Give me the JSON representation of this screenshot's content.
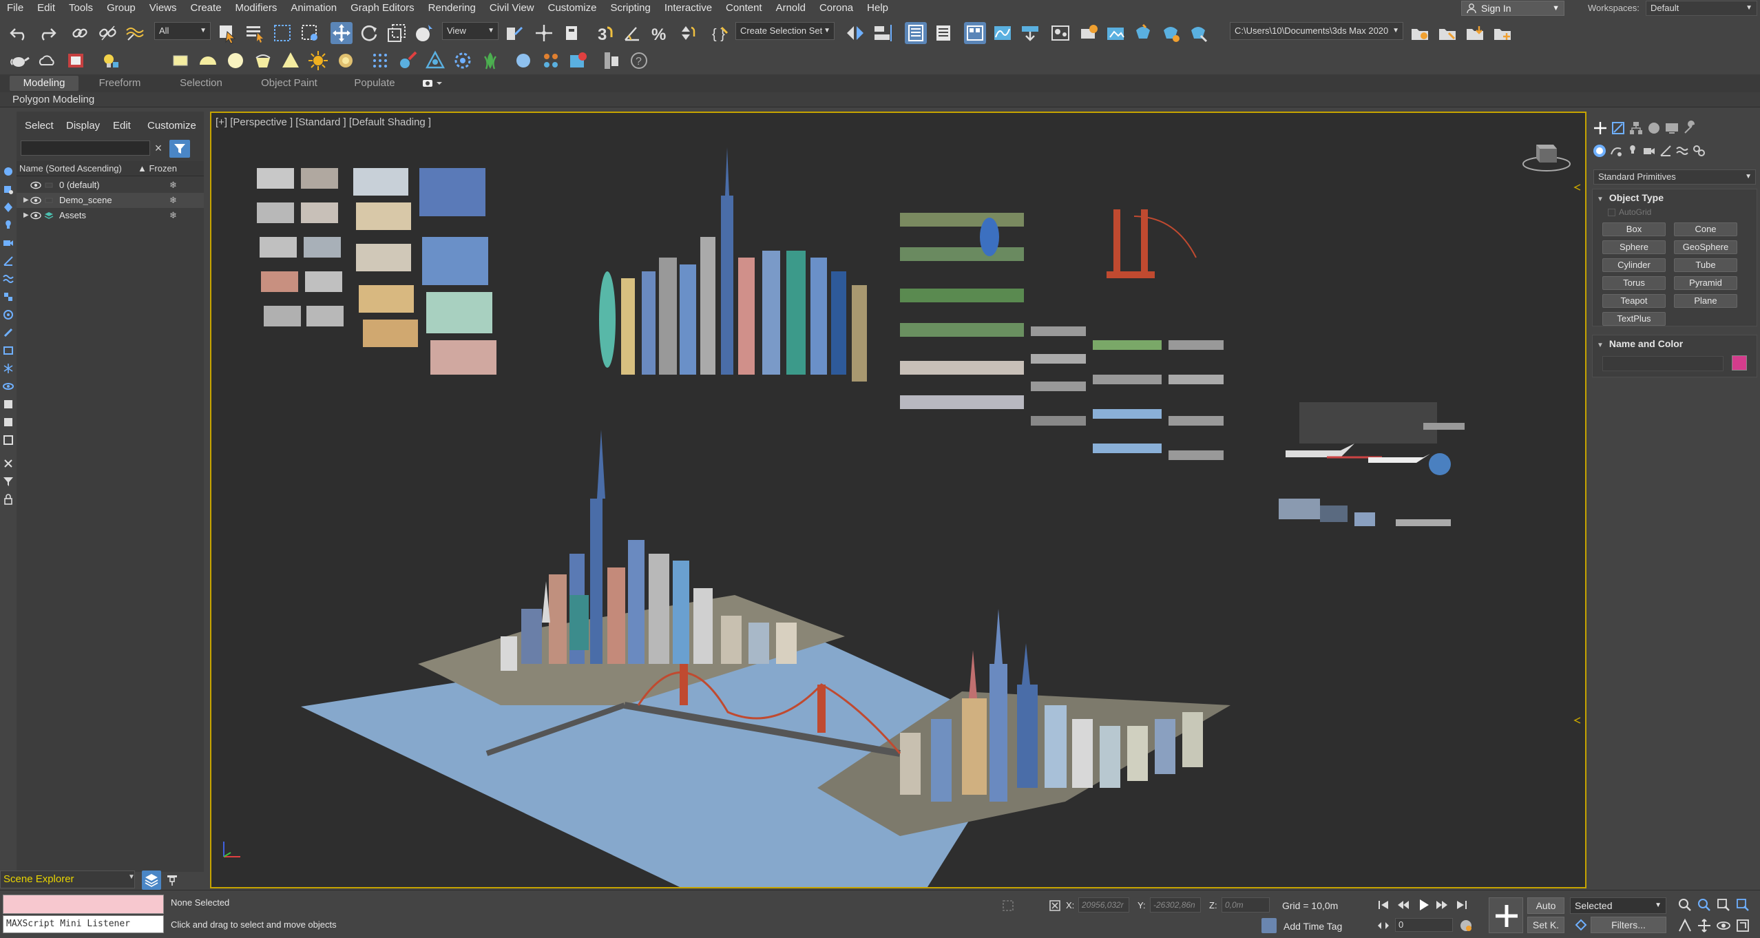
{
  "menu": [
    "File",
    "Edit",
    "Tools",
    "Group",
    "Views",
    "Create",
    "Modifiers",
    "Animation",
    "Graph Editors",
    "Rendering",
    "Civil View",
    "Customize",
    "Scripting",
    "Interactive",
    "Content",
    "Arnold",
    "Corona",
    "Help"
  ],
  "account": {
    "signin": "Sign In",
    "workspaces_label": "Workspaces:",
    "workspace": "Default"
  },
  "toolbar": {
    "selection_filter": "All",
    "ref_coord": "View",
    "named_selection": "Create Selection Set",
    "project_path": "C:\\Users\\10\\Documents\\3ds Max 2020"
  },
  "ribbon": {
    "tabs": [
      "Modeling",
      "Freeform",
      "Selection",
      "Object Paint",
      "Populate"
    ],
    "active_tab": "Modeling",
    "panel": "Polygon Modeling"
  },
  "explorer": {
    "menus": [
      "Select",
      "Display",
      "Edit",
      "Customize"
    ],
    "columns": {
      "name": "Name (Sorted Ascending)",
      "frozen": "▲ Frozen"
    },
    "rows": [
      {
        "name": "0 (default)",
        "expandable": false
      },
      {
        "name": "Demo_scene",
        "expandable": true
      },
      {
        "name": "Assets",
        "expandable": true
      }
    ],
    "footer_label": "Scene Explorer"
  },
  "viewport": {
    "label": "[+] [Perspective ] [Standard ] [Default Shading ]",
    "colors": {
      "border": "#c6a400",
      "water": "#86a8cc",
      "ground": "#2e2e2e"
    }
  },
  "command_panel": {
    "category": "Standard Primitives",
    "object_type": {
      "title": "Object Type",
      "autogrid": "AutoGrid",
      "buttons": [
        "Box",
        "Cone",
        "Sphere",
        "GeoSphere",
        "Cylinder",
        "Tube",
        "Torus",
        "Pyramid",
        "Teapot",
        "Plane",
        "TextPlus"
      ]
    },
    "name_color": {
      "title": "Name and Color",
      "color": "#d43c8c"
    }
  },
  "status": {
    "maxscript": "MAXScript Mini Listener",
    "selection": "None Selected",
    "prompt": "Click and drag to select and move objects",
    "x_label": "X:",
    "x_value": "20956,032r",
    "y_label": "Y:",
    "y_value": "-26302,86n",
    "z_label": "Z:",
    "z_value": "0,0m",
    "grid": "Grid = 10,0m",
    "add_time_tag": "Add Time Tag",
    "frame": "0",
    "auto": "Auto",
    "set_key": "Set K.",
    "key_filter": "Selected",
    "filters": "Filters..."
  }
}
